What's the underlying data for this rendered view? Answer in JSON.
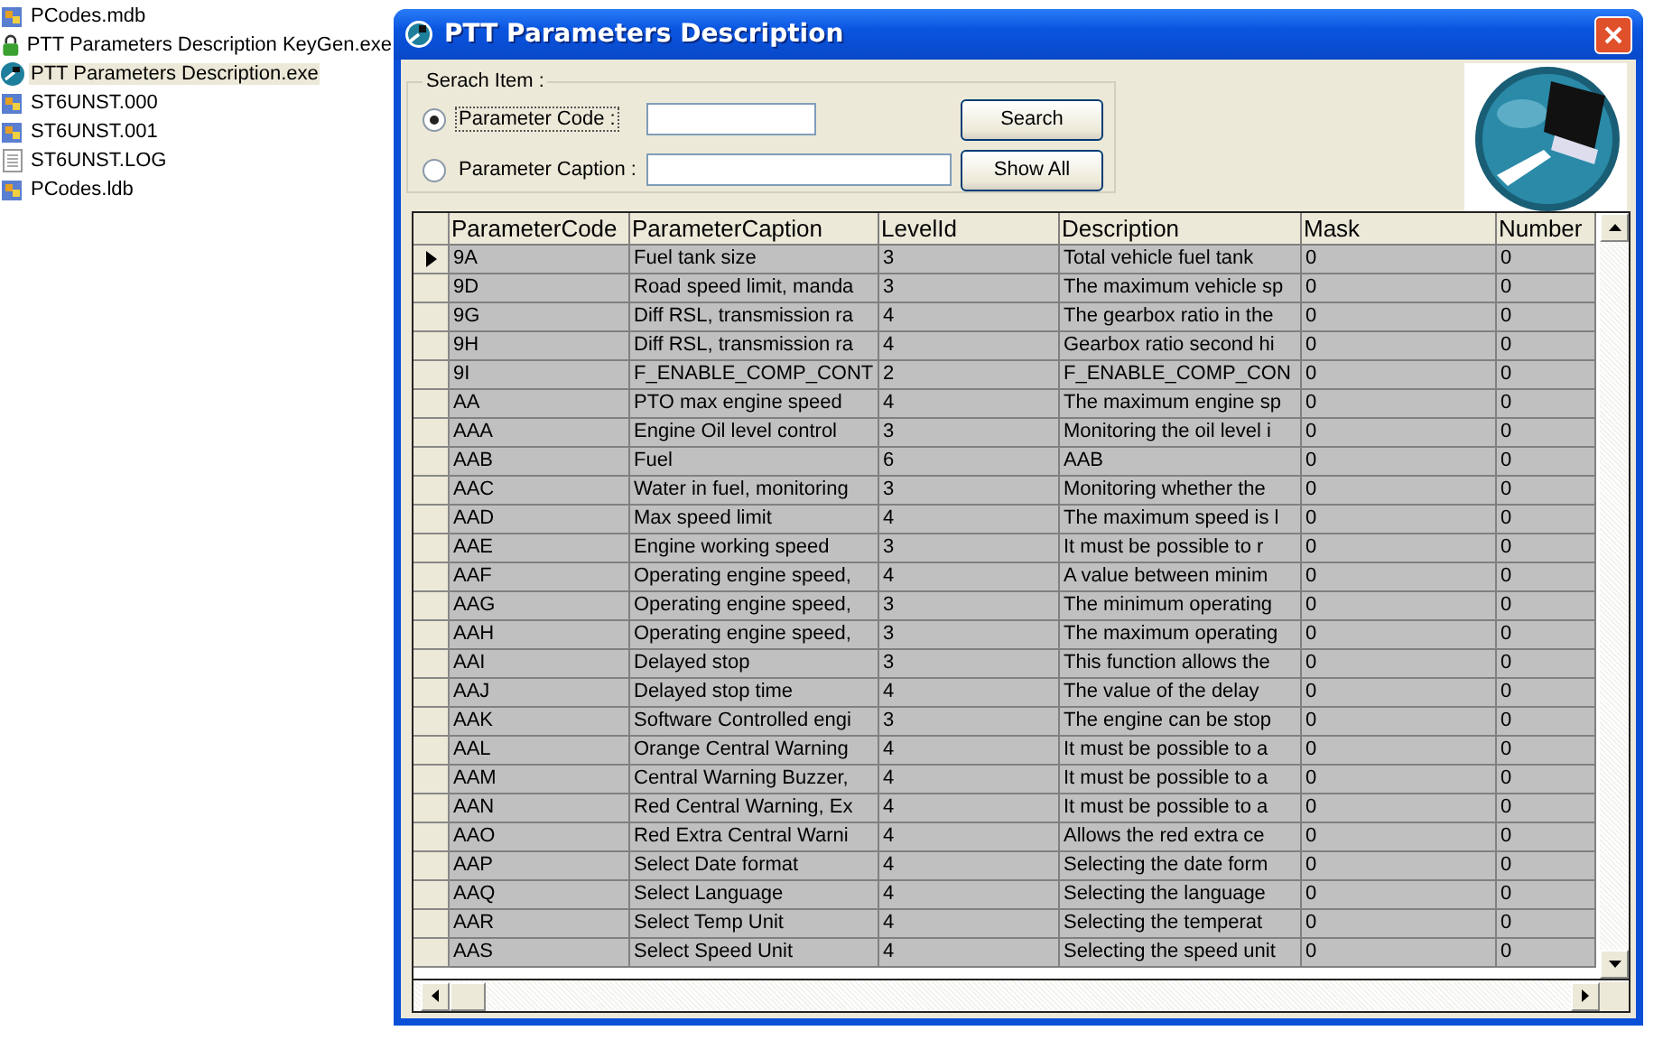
{
  "desktop_files": [
    {
      "name": "PCodes.mdb",
      "kind": "database",
      "selected": false
    },
    {
      "name": "PTT Parameters Description KeyGen.exe",
      "kind": "lock",
      "selected": false
    },
    {
      "name": "PTT Parameters Description.exe",
      "kind": "app",
      "selected": true
    },
    {
      "name": "ST6UNST.000",
      "kind": "database",
      "selected": false
    },
    {
      "name": "ST6UNST.001",
      "kind": "database",
      "selected": false
    },
    {
      "name": "ST6UNST.LOG",
      "kind": "text",
      "selected": false
    },
    {
      "name": "PCodes.ldb",
      "kind": "database",
      "selected": false
    }
  ],
  "window": {
    "title": "PTT Parameters Description"
  },
  "search_group": {
    "title": "Serach Item :",
    "options": [
      {
        "label": "Parameter Code :",
        "selected": true
      },
      {
        "label": "Parameter Caption  :",
        "selected": false
      }
    ],
    "buttons": [
      "Search",
      "Show All"
    ]
  },
  "table": {
    "columns": [
      "ParameterCode",
      "ParameterCaption",
      "LevelId",
      "Description",
      "Mask",
      "Number"
    ],
    "rows": [
      {
        "current": true,
        "cells": [
          "9A",
          "Fuel tank size",
          "3",
          "Total vehicle fuel tank",
          "0",
          "0"
        ]
      },
      {
        "current": false,
        "cells": [
          "9D",
          "Road speed limit, manda",
          "3",
          "The maximum vehicle sp",
          "0",
          "0"
        ]
      },
      {
        "current": false,
        "cells": [
          "9G",
          "Diff RSL, transmission ra",
          "4",
          "The gearbox ratio in the",
          "0",
          "0"
        ]
      },
      {
        "current": false,
        "cells": [
          "9H",
          "Diff RSL, transmission ra",
          "4",
          "Gearbox ratio second hi",
          "0",
          "0"
        ]
      },
      {
        "current": false,
        "cells": [
          "9I",
          "F_ENABLE_COMP_CONT",
          "2",
          "F_ENABLE_COMP_CON",
          "0",
          "0"
        ]
      },
      {
        "current": false,
        "cells": [
          "AA",
          "PTO max engine speed",
          "4",
          "The maximum engine sp",
          "0",
          "0"
        ]
      },
      {
        "current": false,
        "cells": [
          "AAA",
          "Engine Oil level control",
          "3",
          "Monitoring the oil level i",
          "0",
          "0"
        ]
      },
      {
        "current": false,
        "cells": [
          "AAB",
          "Fuel",
          "6",
          "AAB",
          "0",
          "0"
        ]
      },
      {
        "current": false,
        "cells": [
          "AAC",
          "Water in fuel, monitoring",
          "3",
          "Monitoring whether the",
          "0",
          "0"
        ]
      },
      {
        "current": false,
        "cells": [
          "AAD",
          "Max speed limit",
          "4",
          "The maximum speed is l",
          "0",
          "0"
        ]
      },
      {
        "current": false,
        "cells": [
          "AAE",
          "Engine working speed",
          "3",
          "It must be possible to r",
          "0",
          "0"
        ]
      },
      {
        "current": false,
        "cells": [
          "AAF",
          "Operating engine speed,",
          "4",
          "A value between minim",
          "0",
          "0"
        ]
      },
      {
        "current": false,
        "cells": [
          "AAG",
          "Operating engine speed,",
          "3",
          "The minimum operating",
          "0",
          "0"
        ]
      },
      {
        "current": false,
        "cells": [
          "AAH",
          "Operating engine speed,",
          "3",
          "The maximum operating",
          "0",
          "0"
        ]
      },
      {
        "current": false,
        "cells": [
          "AAI",
          "Delayed stop",
          "3",
          "This function allows the",
          "0",
          "0"
        ]
      },
      {
        "current": false,
        "cells": [
          "AAJ",
          "Delayed stop time",
          "4",
          "The value of the delay",
          "0",
          "0"
        ]
      },
      {
        "current": false,
        "cells": [
          "AAK",
          "Software Controlled engi",
          "3",
          "The engine can be stop",
          "0",
          "0"
        ]
      },
      {
        "current": false,
        "cells": [
          "AAL",
          "Orange Central Warning",
          "4",
          "It must be possible to a",
          "0",
          "0"
        ]
      },
      {
        "current": false,
        "cells": [
          "AAM",
          "Central Warning Buzzer,",
          "4",
          "It must be possible to a",
          "0",
          "0"
        ]
      },
      {
        "current": false,
        "cells": [
          "AAN",
          "Red Central Warning, Ex",
          "4",
          "It must be possible to a",
          "0",
          "0"
        ]
      },
      {
        "current": false,
        "cells": [
          "AAO",
          "Red Extra Central Warni",
          "4",
          "Allows the red extra ce",
          "0",
          "0"
        ]
      },
      {
        "current": false,
        "cells": [
          "AAP",
          "Select Date format",
          "4",
          "Selecting the date form",
          "0",
          "0"
        ]
      },
      {
        "current": false,
        "cells": [
          "AAQ",
          "Select Language",
          "4",
          "Selecting the language",
          "0",
          "0"
        ]
      },
      {
        "current": false,
        "cells": [
          "AAR",
          "Select Temp Unit",
          "4",
          "Selecting the temperat",
          "0",
          "0"
        ]
      },
      {
        "current": false,
        "cells": [
          "AAS",
          "Select Speed Unit",
          "4",
          "Selecting the speed unit",
          "0",
          "0"
        ]
      }
    ]
  }
}
